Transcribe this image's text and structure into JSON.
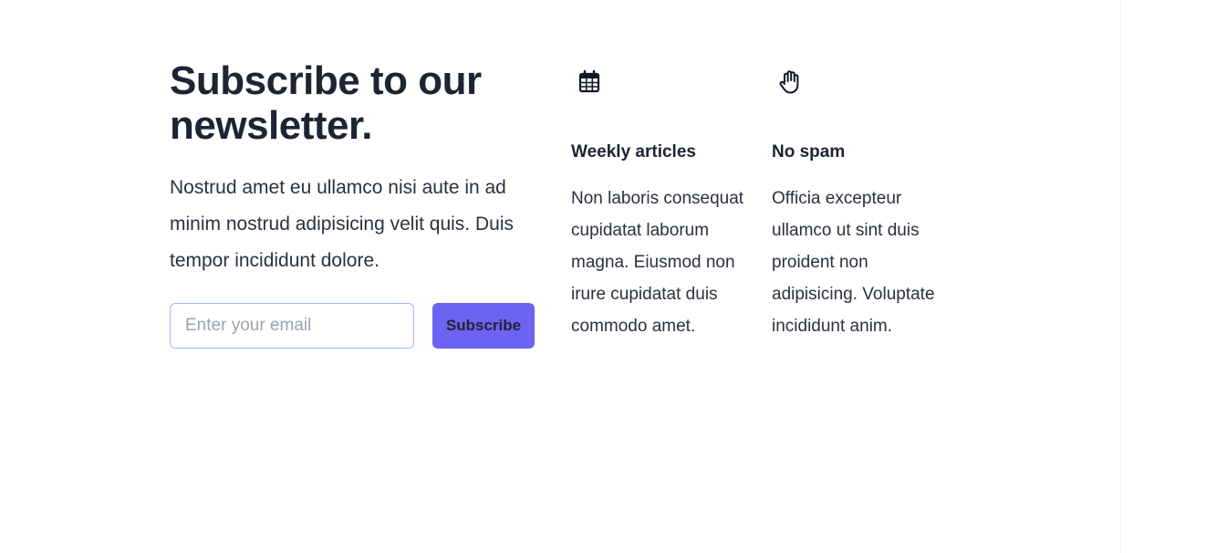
{
  "newsletter": {
    "heading": "Subscribe to our newsletter.",
    "description": "Nostrud amet eu ullamco nisi aute in ad minim nostrud adipisicing velit quis. Duis tempor incididunt dolore.",
    "email_placeholder": "Enter your email",
    "email_value": "",
    "subscribe_label": "Subscribe",
    "accent_color": "#6c63f2",
    "input_border_color": "#a5b4fc"
  },
  "features": [
    {
      "icon": "calendar-icon",
      "title": "Weekly articles",
      "text": "Non laboris consequat cupidatat laborum magna. Eiusmod non irure cupidatat duis commodo amet."
    },
    {
      "icon": "hand-raised-icon",
      "title": "No spam",
      "text": "Officia excepteur ullamco ut sint duis proident non adipisicing. Voluptate incididunt anim."
    }
  ]
}
